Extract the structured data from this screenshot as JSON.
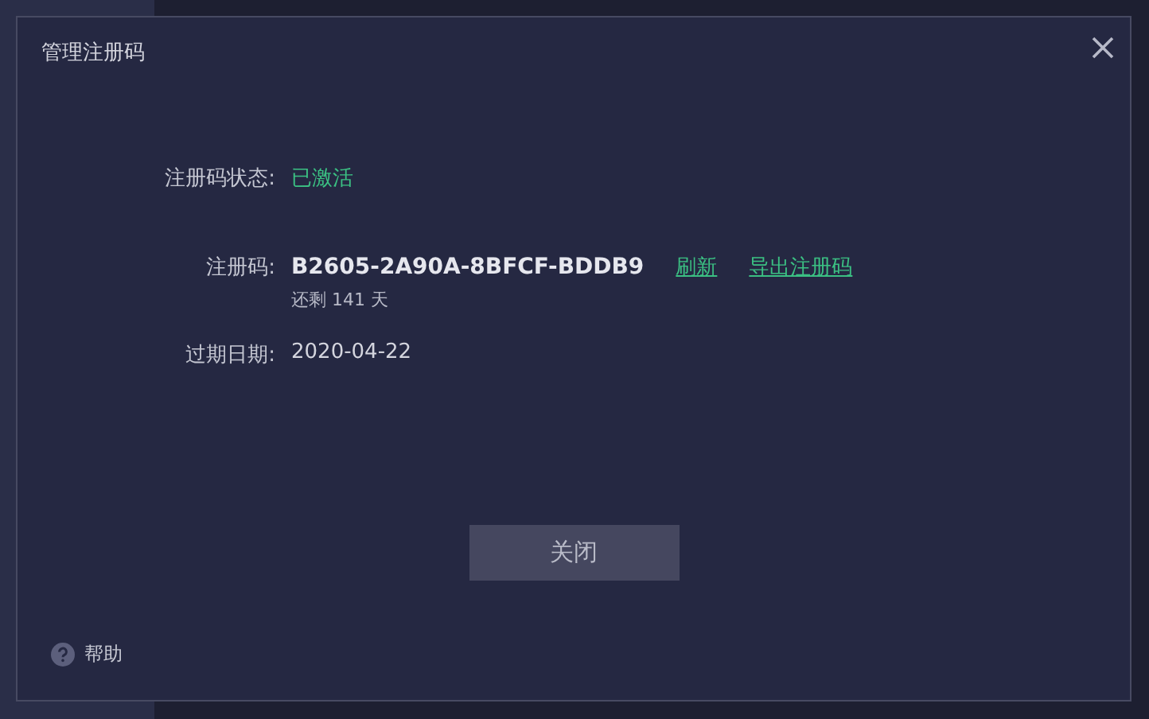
{
  "dialog": {
    "title": "管理注册码",
    "status": {
      "label": "注册码状态:",
      "value": "已激活"
    },
    "code": {
      "label": "注册码:",
      "value": "B2605-2A90A-8BFCF-BDDB9",
      "links": [
        "刷新",
        "导出注册码"
      ],
      "remaining": "还剩 141 天"
    },
    "expiry": {
      "label": "过期日期:",
      "value": "2020-04-22"
    },
    "close_button": "关闭",
    "help": "帮助"
  }
}
